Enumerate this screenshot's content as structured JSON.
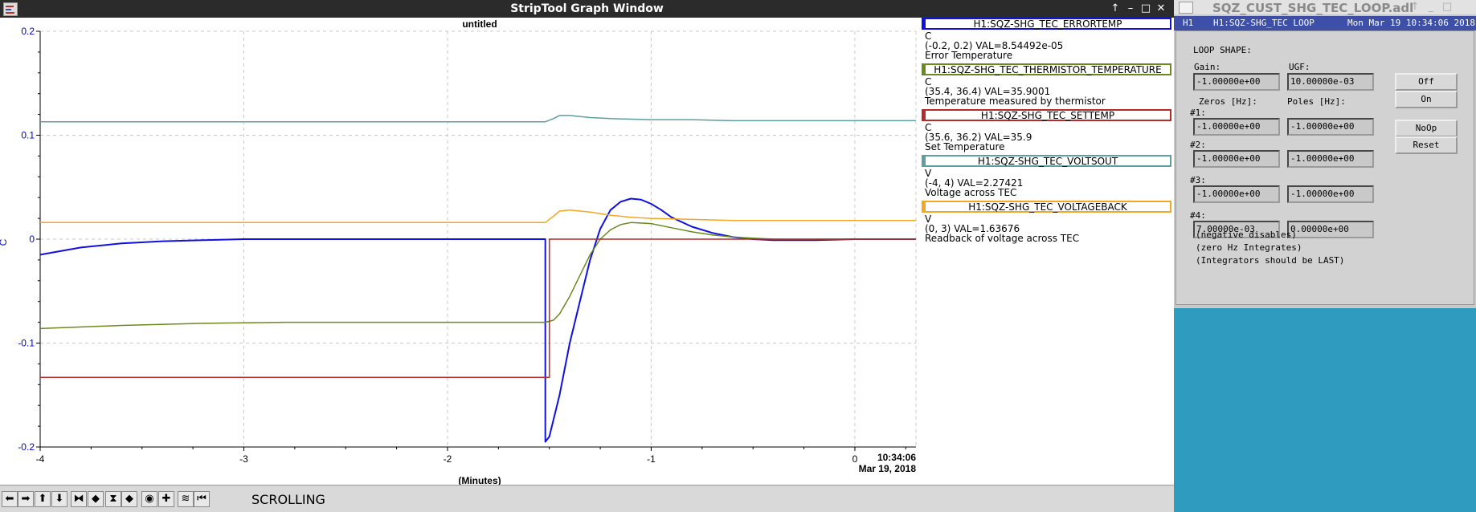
{
  "strip": {
    "window_title": "StripTool Graph Window",
    "graph_title": "untitled",
    "y_axis_unit": "C",
    "x_axis_label": "(Minutes)",
    "timestamp_time": "10:34:06",
    "timestamp_date": "Mar 19, 2018",
    "mode_label": "SCROLLING",
    "window_buttons": [
      "↑",
      "–",
      "□",
      "✕"
    ],
    "toolbar_icons": [
      "arrow-left-icon",
      "arrow-right-icon",
      "arrow-up-icon",
      "arrow-down-icon",
      "zoom-in-x-icon",
      "zoom-out-x-icon",
      "zoom-in-y-icon",
      "zoom-out-y-icon",
      "record-icon",
      "crosshair-icon",
      "refresh-icon",
      "pause-icon"
    ],
    "toolbar_glyphs": [
      "⬅",
      "➡",
      "⬆",
      "⬇",
      "⧓",
      "◆",
      "⧗",
      "◆",
      "◉",
      "✚",
      "≋",
      "⏮"
    ]
  },
  "legend": [
    {
      "name": "H1:SQZ-SHG_TEC_ERRORTEMP",
      "color": "#1010e0",
      "unit": "C",
      "range": "(-0.2, 0.2) VAL=8.54492e-05",
      "desc": "Error Temperature"
    },
    {
      "name": "H1:SQZ-SHG_TEC_THERMISTOR_TEMPERATURE",
      "color": "#6b8a1e",
      "unit": "C",
      "range": "(35.4, 36.4) VAL=35.9001",
      "desc": "Temperature measured by thermistor"
    },
    {
      "name": "H1:SQZ-SHG_TEC_SETTEMP",
      "color": "#b52a2a",
      "unit": "C",
      "range": "(35.6, 36.2) VAL=35.9",
      "desc": "Set Temperature"
    },
    {
      "name": "H1:SQZ-SHG_TEC_VOLTSOUT",
      "color": "#5f9ea0",
      "unit": "V",
      "range": "(-4, 4) VAL=2.27421",
      "desc": "Voltage across TEC"
    },
    {
      "name": "H1:SQZ-SHG_TEC_VOLTAGEBACK",
      "color": "#f5a623",
      "unit": "V",
      "range": "(0, 3) VAL=1.63676",
      "desc": "Readback of voltage across TEC"
    }
  ],
  "chart_data": {
    "type": "line",
    "title": "untitled",
    "xlabel": "(Minutes)",
    "ylabel": "C",
    "xlim": [
      -4,
      0.3
    ],
    "ylim": [
      -0.2,
      0.2
    ],
    "x_ticks": [
      "-4",
      "-3",
      "-2",
      "-1",
      "0"
    ],
    "y_ticks": [
      "0.2",
      "0.1",
      "0",
      "-0.1",
      "-0.2"
    ],
    "grid": true,
    "series": [
      {
        "name": "H1:SQZ-SHG_TEC_ERRORTEMP",
        "color": "#1010e0",
        "x": [
          -4,
          -3.8,
          -3.6,
          -3.4,
          -3.2,
          -3.0,
          -1.52,
          -1.52,
          -1.5,
          -1.45,
          -1.4,
          -1.35,
          -1.3,
          -1.25,
          -1.2,
          -1.15,
          -1.1,
          -1.05,
          -1.0,
          -0.95,
          -0.9,
          -0.8,
          -0.7,
          -0.6,
          -0.5,
          -0.4,
          -0.2,
          0.0,
          0.2,
          0.3
        ],
        "y": [
          -0.015,
          -0.008,
          -0.004,
          -0.002,
          -0.001,
          0.0,
          0.0,
          -0.195,
          -0.19,
          -0.15,
          -0.1,
          -0.06,
          -0.02,
          0.01,
          0.028,
          0.036,
          0.039,
          0.038,
          0.034,
          0.028,
          0.021,
          0.012,
          0.006,
          0.002,
          0.0,
          -0.001,
          -0.001,
          0.0,
          0.0,
          0.0
        ]
      },
      {
        "name": "H1:SQZ-SHG_TEC_THERMISTOR_TEMPERATURE",
        "color": "#6b8a1e",
        "x": [
          -4,
          -3.6,
          -3.2,
          -2.8,
          -2.4,
          -2.0,
          -1.6,
          -1.52,
          -1.48,
          -1.45,
          -1.4,
          -1.35,
          -1.3,
          -1.25,
          -1.2,
          -1.15,
          -1.1,
          -1.0,
          -0.9,
          -0.8,
          -0.7,
          -0.6,
          -0.5,
          -0.4,
          -0.3,
          0.0,
          0.3
        ],
        "y": [
          -0.086,
          -0.083,
          -0.081,
          -0.08,
          -0.08,
          -0.08,
          -0.08,
          -0.08,
          -0.078,
          -0.072,
          -0.055,
          -0.035,
          -0.015,
          0.0,
          0.009,
          0.014,
          0.016,
          0.015,
          0.011,
          0.007,
          0.004,
          0.002,
          0.001,
          0.0,
          0.0,
          0.0,
          0.0
        ]
      },
      {
        "name": "H1:SQZ-SHG_TEC_SETTEMP",
        "color": "#b52a2a",
        "x": [
          -4,
          -1.5,
          -1.5,
          0.3
        ],
        "y": [
          -0.133,
          -0.133,
          0.0,
          0.0
        ]
      },
      {
        "name": "H1:SQZ-SHG_TEC_VOLTSOUT",
        "color": "#5f9ea0",
        "x": [
          -4,
          -1.52,
          -1.48,
          -1.45,
          -1.4,
          -1.3,
          -1.2,
          -1.0,
          -0.8,
          -0.6,
          0.0,
          0.3
        ],
        "y": [
          0.113,
          0.113,
          0.116,
          0.119,
          0.119,
          0.117,
          0.116,
          0.115,
          0.115,
          0.114,
          0.114,
          0.114
        ]
      },
      {
        "name": "H1:SQZ-SHG_TEC_VOLTAGEBACK",
        "color": "#f5a623",
        "x": [
          -4,
          -1.52,
          -1.48,
          -1.45,
          -1.4,
          -1.3,
          -1.2,
          -1.1,
          -1.0,
          -0.8,
          -0.6,
          -0.4,
          0.0,
          0.3
        ],
        "y": [
          0.016,
          0.016,
          0.022,
          0.027,
          0.028,
          0.026,
          0.023,
          0.021,
          0.02,
          0.019,
          0.018,
          0.018,
          0.018,
          0.018
        ]
      }
    ]
  },
  "medm": {
    "window_title": "SQZ_CUST_SHG_TEC_LOOP.adl",
    "header_ifo": "H1",
    "header_name": "H1:SQZ-SHG_TEC LOOP",
    "header_date": "Mon Mar 19 10:34:06 2018",
    "loop_shape_label": "LOOP SHAPE:",
    "gain_label": "Gain:",
    "ugf_label": "UGF:",
    "gain_value": "-1.00000e+00",
    "ugf_value": "10.00000e-03",
    "zeros_label": "Zeros [Hz]:",
    "poles_label": "Poles [Hz]:",
    "rows": [
      {
        "label": "#1:",
        "zero": "-1.00000e+00",
        "pole": "-1.00000e+00"
      },
      {
        "label": "#2:",
        "zero": "-1.00000e+00",
        "pole": "-1.00000e+00"
      },
      {
        "label": "#3:",
        "zero": "-1.00000e+00",
        "pole": "-1.00000e+00"
      },
      {
        "label": "#4:",
        "zero": "7.00000e-03",
        "pole": "0.00000e+00"
      }
    ],
    "buttons": {
      "off": "Off",
      "on": "On",
      "noop": "NoOp",
      "reset": "Reset"
    },
    "notes": [
      "(negative disables)",
      "(zero Hz Integrates)",
      "(Integrators should be LAST)"
    ],
    "window_buttons": [
      "↑",
      "_",
      "□"
    ]
  }
}
